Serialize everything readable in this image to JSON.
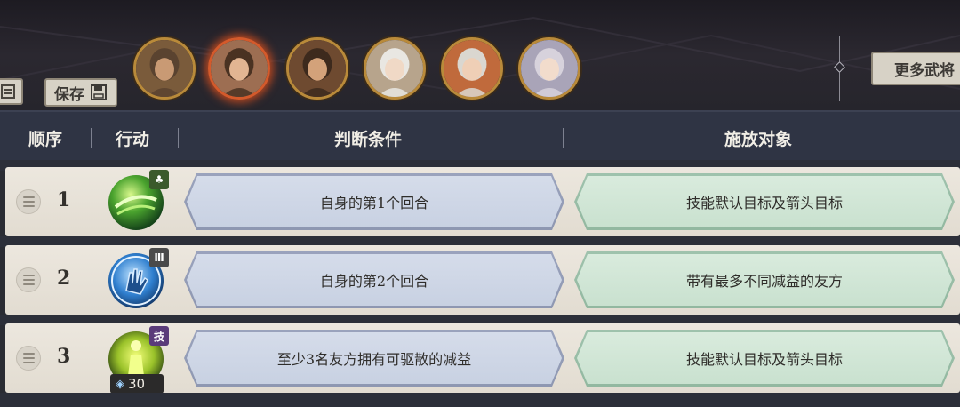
{
  "toolbar": {
    "save_label": "保存",
    "more_label": "更多武将"
  },
  "avatars": [
    {
      "name": "hero-1",
      "selected": false,
      "hair": "#5a4330",
      "skin": "#c99a74",
      "bg": "#7a5b3b"
    },
    {
      "name": "hero-2",
      "selected": true,
      "hair": "#4a3222",
      "skin": "#e2b592",
      "bg": "#9d6e52"
    },
    {
      "name": "hero-3",
      "selected": false,
      "hair": "#3d2a1d",
      "skin": "#d3a27a",
      "bg": "#6e4a30"
    },
    {
      "name": "hero-4",
      "selected": false,
      "hair": "#e9e7e2",
      "skin": "#f0d9c6",
      "bg": "#b7a48c"
    },
    {
      "name": "hero-5",
      "selected": false,
      "hair": "#dad7d0",
      "skin": "#efcfb6",
      "bg": "#c06a3c"
    },
    {
      "name": "hero-6",
      "selected": false,
      "hair": "#d7d2dc",
      "skin": "#f2dccc",
      "bg": "#a9a4b8"
    }
  ],
  "header": {
    "order": "顺序",
    "action": "行动",
    "condition": "判断条件",
    "target": "施放对象"
  },
  "rows": [
    {
      "order": "1",
      "skill_icon": "green-orb-icon",
      "condition": "自身的第1个回合",
      "target": "技能默认目标及箭头目标"
    },
    {
      "order": "2",
      "skill_icon": "blue-hand-icon",
      "condition": "自身的第2个回合",
      "target": "带有最多不同减益的友方"
    },
    {
      "order": "3",
      "skill_icon": "yellow-figure-icon",
      "skill_badge": "技",
      "skill_cost": "30",
      "condition": "至少3名友方拥有可驱散的减益",
      "target": "技能默认目标及箭头目标"
    }
  ],
  "colors": {
    "header_bg": "#2f3444",
    "row_bg": "#e6e1d7",
    "condition_blue": "#d5dcea",
    "target_green": "#d9ebdd",
    "selected_ring": "#d45a2b"
  }
}
